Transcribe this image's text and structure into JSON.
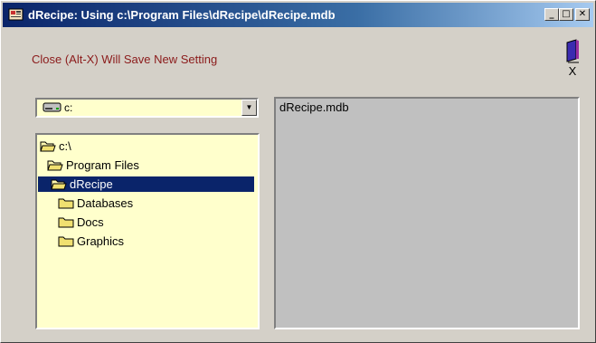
{
  "window": {
    "title": "dRecipe: Using c:\\Program Files\\dRecipe\\dRecipe.mdb",
    "minimize_glyph": "_",
    "maximize_glyph": "□",
    "close_glyph": "✕"
  },
  "notice": "Close (Alt-X) Will Save New Setting",
  "exit_button": {
    "icon": "exit-door-icon",
    "glyph": "X"
  },
  "drive": {
    "value": "c:",
    "arrow": "▼"
  },
  "directories": [
    {
      "label": "c:\\",
      "state": "open"
    },
    {
      "label": "Program Files",
      "state": "open"
    },
    {
      "label": "dRecipe",
      "state": "open",
      "selected": true
    },
    {
      "label": "Databases",
      "state": "closed"
    },
    {
      "label": "Docs",
      "state": "closed"
    },
    {
      "label": "Graphics",
      "state": "closed"
    }
  ],
  "files": [
    "dRecipe.mdb"
  ],
  "colors": {
    "titlebar": "#0a246a",
    "notice_text": "#8b1a1a",
    "list_background": "#ffffcc",
    "selection": "#0a246a"
  }
}
